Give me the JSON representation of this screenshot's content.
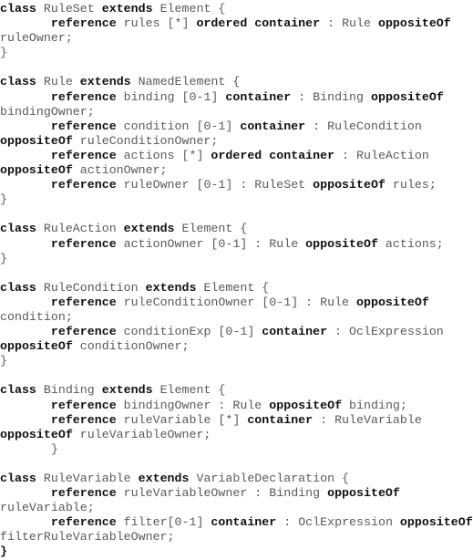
{
  "document": {
    "lines": [
      [
        {
          "k": "class"
        },
        {
          "t": " RuleSet "
        },
        {
          "k": "extends"
        },
        {
          "t": " Element {"
        }
      ],
      [
        {
          "t": "       "
        },
        {
          "k": "reference"
        },
        {
          "t": " rules [*] "
        },
        {
          "k": "ordered container"
        },
        {
          "t": " : Rule "
        },
        {
          "k": "oppositeOf"
        }
      ],
      [
        {
          "t": "ruleOwner;"
        }
      ],
      [
        {
          "t": "}"
        }
      ],
      [
        {
          "t": ""
        }
      ],
      [
        {
          "k": "class"
        },
        {
          "t": " Rule "
        },
        {
          "k": "extends"
        },
        {
          "t": " NamedElement {"
        }
      ],
      [
        {
          "t": "       "
        },
        {
          "k": "reference"
        },
        {
          "t": " binding [0-1] "
        },
        {
          "k": "container"
        },
        {
          "t": " : Binding "
        },
        {
          "k": "oppositeOf"
        }
      ],
      [
        {
          "t": "bindingOwner;"
        }
      ],
      [
        {
          "t": "       "
        },
        {
          "k": "reference"
        },
        {
          "t": " condition [0-1] "
        },
        {
          "k": "container"
        },
        {
          "t": " : RuleCondition"
        }
      ],
      [
        {
          "k": "oppositeOf"
        },
        {
          "t": " ruleConditionOwner;"
        }
      ],
      [
        {
          "t": "       "
        },
        {
          "k": "reference"
        },
        {
          "t": " actions [*] "
        },
        {
          "k": "ordered container"
        },
        {
          "t": " : RuleAction"
        }
      ],
      [
        {
          "k": "oppositeOf"
        },
        {
          "t": " actionOwner;"
        }
      ],
      [
        {
          "t": "       "
        },
        {
          "k": "reference"
        },
        {
          "t": " ruleOwner [0-1] : RuleSet "
        },
        {
          "k": "oppositeOf"
        },
        {
          "t": " rules;"
        }
      ],
      [
        {
          "t": "}"
        }
      ],
      [
        {
          "t": ""
        }
      ],
      [
        {
          "k": "class"
        },
        {
          "t": " RuleAction "
        },
        {
          "k": "extends"
        },
        {
          "t": " Element {"
        }
      ],
      [
        {
          "t": "       "
        },
        {
          "k": "reference"
        },
        {
          "t": " actionOwner [0-1] : Rule "
        },
        {
          "k": "oppositeOf"
        },
        {
          "t": " actions;"
        }
      ],
      [
        {
          "t": "}"
        }
      ],
      [
        {
          "t": ""
        }
      ],
      [
        {
          "k": "class"
        },
        {
          "t": " RuleCondition "
        },
        {
          "k": "extends"
        },
        {
          "t": " Element {"
        }
      ],
      [
        {
          "t": "       "
        },
        {
          "k": "reference"
        },
        {
          "t": " ruleConditionOwner [0-1] : Rule "
        },
        {
          "k": "oppositeOf"
        }
      ],
      [
        {
          "t": "condition;"
        }
      ],
      [
        {
          "t": "       "
        },
        {
          "k": "reference"
        },
        {
          "t": " conditionExp [0-1] "
        },
        {
          "k": "container"
        },
        {
          "t": " : OclExpression"
        }
      ],
      [
        {
          "k": "oppositeOf"
        },
        {
          "t": " conditionOwner;"
        }
      ],
      [
        {
          "t": "}"
        }
      ],
      [
        {
          "t": ""
        }
      ],
      [
        {
          "k": "class"
        },
        {
          "t": " Binding "
        },
        {
          "k": "extends"
        },
        {
          "t": " Element {"
        }
      ],
      [
        {
          "t": "       "
        },
        {
          "k": "reference"
        },
        {
          "t": " bindingOwner : Rule "
        },
        {
          "k": "oppositeOf"
        },
        {
          "t": " binding;"
        }
      ],
      [
        {
          "t": "       "
        },
        {
          "k": "reference"
        },
        {
          "t": " ruleVariable [*] "
        },
        {
          "k": "container"
        },
        {
          "t": " : RuleVariable"
        }
      ],
      [
        {
          "k": "oppositeOf"
        },
        {
          "t": " ruleVariableOwner;"
        }
      ],
      [
        {
          "t": "       }"
        }
      ],
      [
        {
          "t": ""
        }
      ],
      [
        {
          "k": "class"
        },
        {
          "t": " RuleVariable "
        },
        {
          "k": "extends"
        },
        {
          "t": " VariableDeclaration {"
        }
      ],
      [
        {
          "t": "       "
        },
        {
          "k": "reference"
        },
        {
          "t": " ruleVariableOwner : Binding "
        },
        {
          "k": "oppositeOf"
        }
      ],
      [
        {
          "t": "ruleVariable;"
        }
      ],
      [
        {
          "t": "       "
        },
        {
          "k": "reference"
        },
        {
          "t": " filter[0-1] "
        },
        {
          "k": "container"
        },
        {
          "t": " : OclExpression "
        },
        {
          "k": "oppositeOf"
        }
      ],
      [
        {
          "t": "filterRuleVariableOwner;"
        }
      ],
      [
        {
          "k": "}"
        }
      ]
    ]
  },
  "colors": {
    "keyword": "#111111",
    "text": "#5a5a5a",
    "background": "#ffffff"
  }
}
